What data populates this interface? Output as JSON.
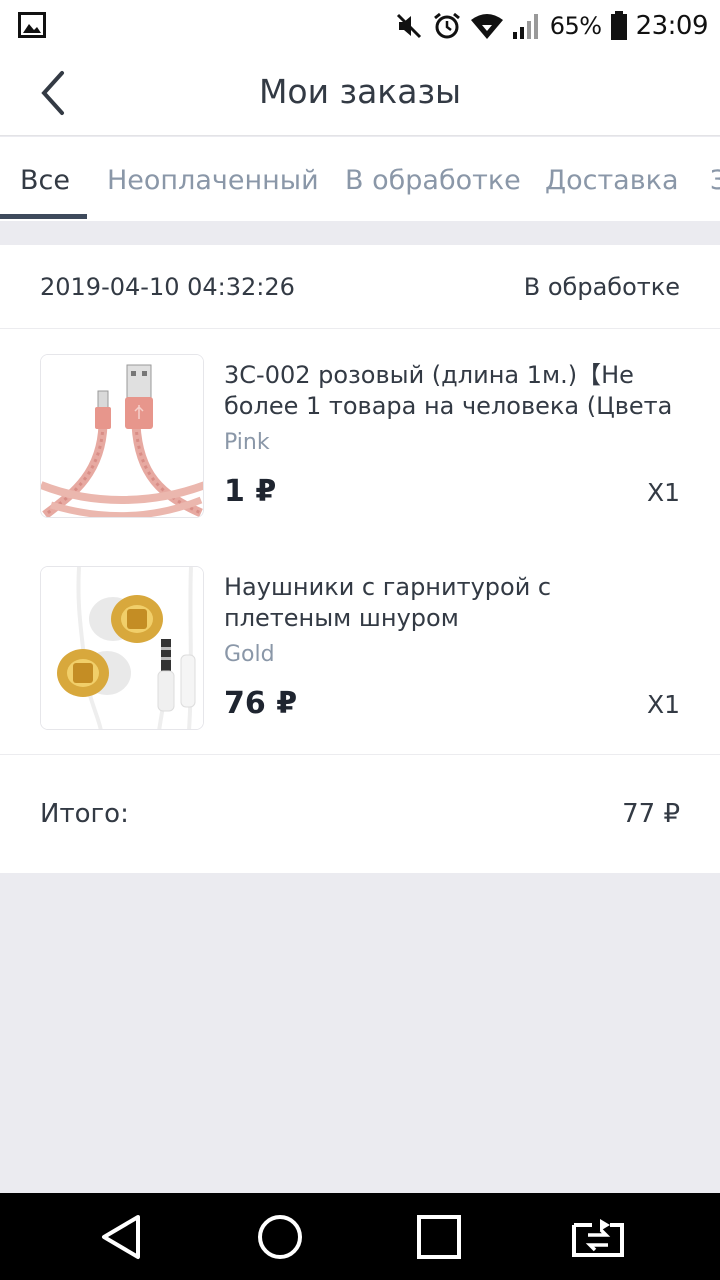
{
  "status_bar": {
    "battery_percent": "65%",
    "time": "23:09",
    "icons": [
      "gallery-icon",
      "mute-icon",
      "alarm-icon",
      "wifi-icon",
      "signal-icon",
      "battery-icon"
    ]
  },
  "header": {
    "title": "Мои заказы",
    "back_icon": "chevron-left-icon"
  },
  "tabs": [
    {
      "label": "Все",
      "active": true
    },
    {
      "label": "Неоплаченный",
      "active": false
    },
    {
      "label": "В обработке",
      "active": false
    },
    {
      "label": "Доставка",
      "active": false
    },
    {
      "label": "З",
      "active": false
    }
  ],
  "order": {
    "date": "2019-04-10 04:32:26",
    "status": "В обработке",
    "items": [
      {
        "name": "3C-002 розовый (длина 1м.)【Не более 1 товара на человека (Цвета",
        "variant": "Pink",
        "price": "1 ₽",
        "qty": "X1",
        "image": "pink-usb-cable-image"
      },
      {
        "name": "Наушники с гарнитурой с плетеным шнуром",
        "variant": "Gold",
        "price": "76 ₽",
        "qty": "X1",
        "image": "gold-earphones-image"
      }
    ],
    "total_label": "Итого:",
    "total_value": "77 ₽"
  },
  "nav_bar": {
    "buttons": [
      "back-triangle-icon",
      "home-circle-icon",
      "recents-square-icon",
      "switch-apps-icon"
    ]
  },
  "colors": {
    "background": "#ebebf0",
    "text": "#333a44",
    "muted": "#8a97a8",
    "indicator": "#3e4a5c"
  }
}
